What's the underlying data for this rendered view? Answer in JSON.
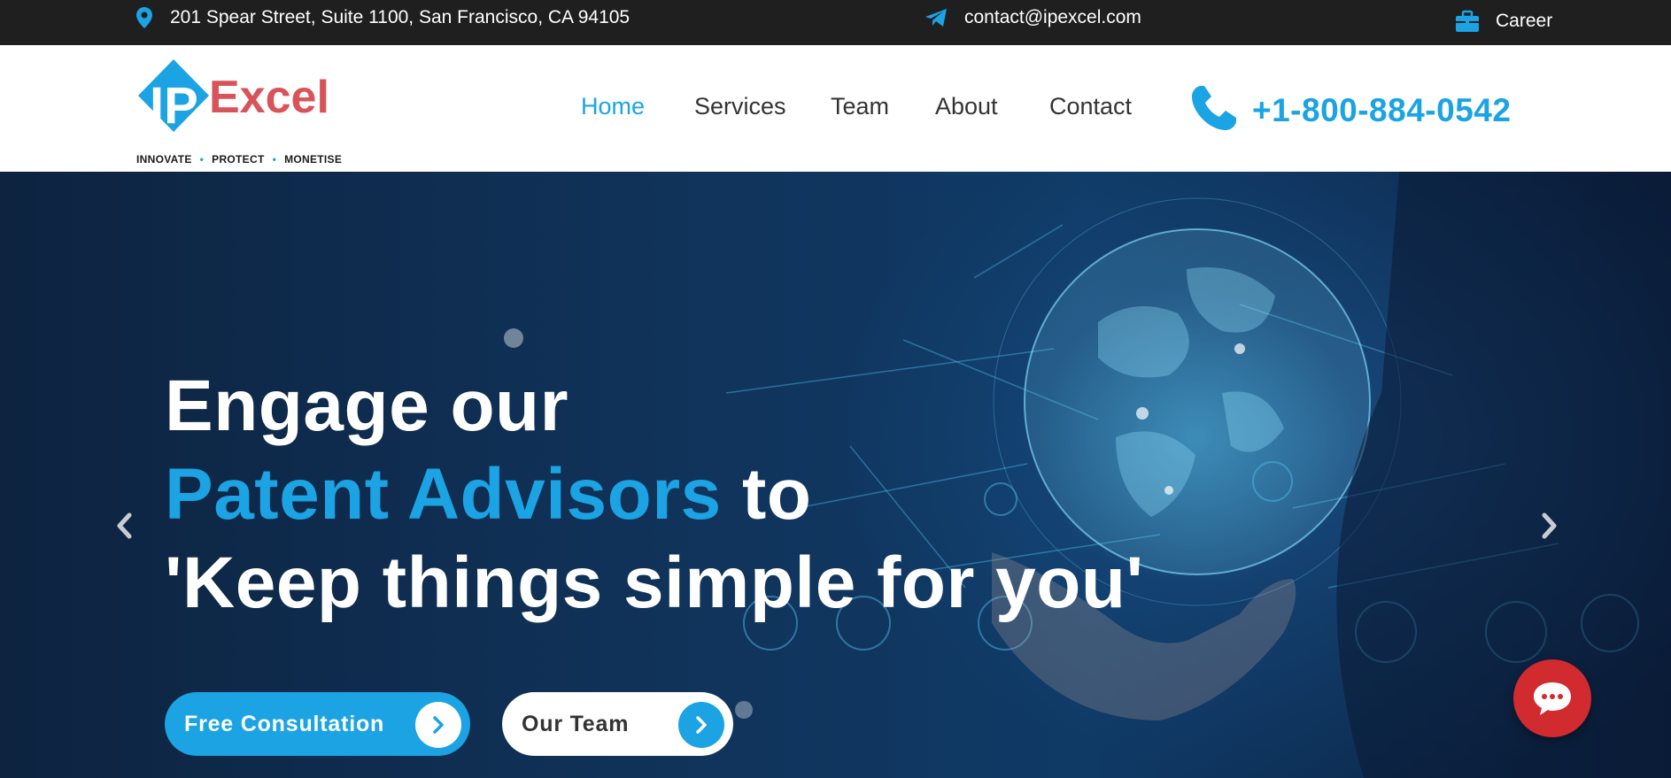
{
  "topbar": {
    "address": "201 Spear Street, Suite 1100, San Francisco, CA 94105",
    "email": "contact@ipexcel.com",
    "career": "Career"
  },
  "logo": {
    "mark": "IP",
    "name": "Excel",
    "tagline": [
      "INNOVATE",
      "PROTECT",
      "MONETISE"
    ]
  },
  "nav": {
    "items": [
      {
        "label": "Home",
        "active": true
      },
      {
        "label": "Services",
        "active": false
      },
      {
        "label": "Team",
        "active": false
      },
      {
        "label": "About",
        "active": false
      },
      {
        "label": "Contact",
        "active": false
      }
    ]
  },
  "phone": {
    "number": "+1-800-884-0542"
  },
  "hero": {
    "line1": "Engage our",
    "line2_accent": "Patent Advisors",
    "line2_rest": " to",
    "line3": "'Keep things simple for you'",
    "primary_button": "Free Consultation",
    "secondary_button": "Our Team"
  },
  "colors": {
    "accent": "#1ba3e3",
    "logo_red": "#d9535a",
    "topbar": "#1f1f1f",
    "chat": "#d12a2f"
  },
  "icons": [
    "location-pin-icon",
    "telegram-icon",
    "briefcase-icon",
    "phone-icon",
    "chevron-left-icon",
    "chevron-right-icon",
    "chat-bubble-icon"
  ]
}
